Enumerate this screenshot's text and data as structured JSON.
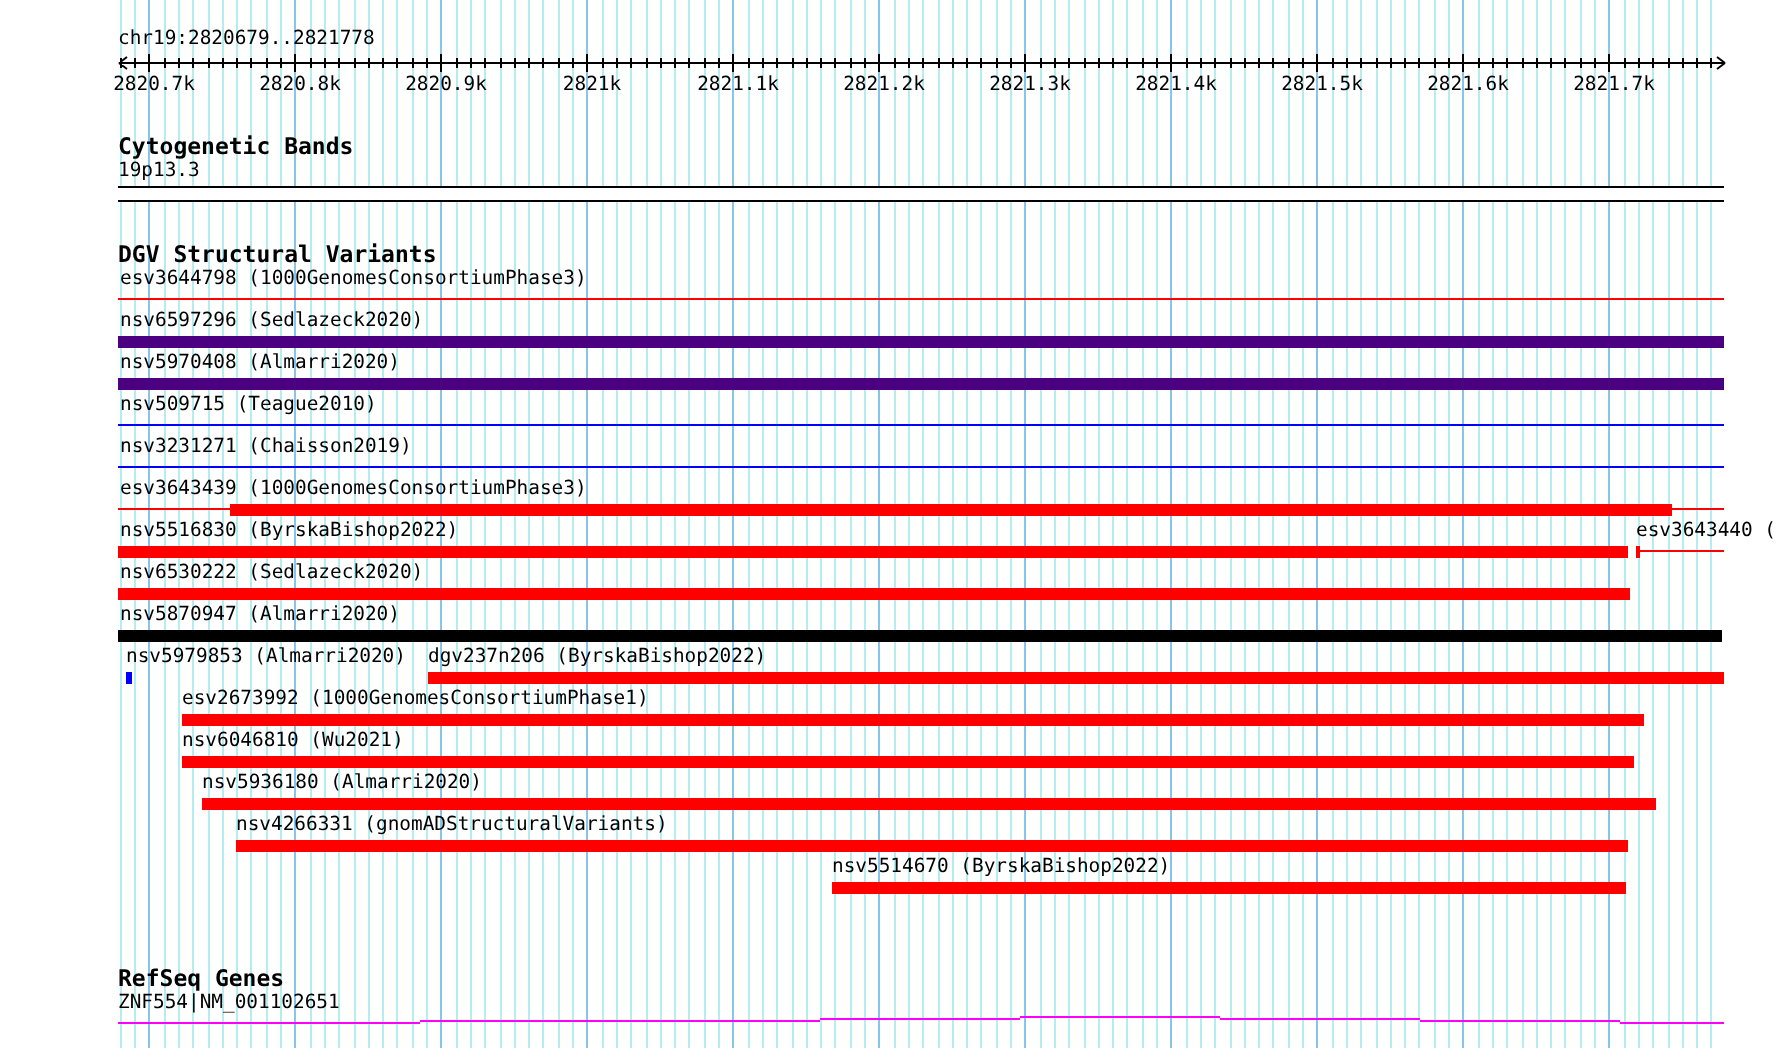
{
  "ruler": {
    "label": "chr19:2820679..2821778",
    "ticks": [
      {
        "label": "2820.7k"
      },
      {
        "label": "2820.8k"
      },
      {
        "label": "2820.9k"
      },
      {
        "label": "2821k"
      },
      {
        "label": "2821.1k"
      },
      {
        "label": "2821.2k"
      },
      {
        "label": "2821.3k"
      },
      {
        "label": "2821.4k"
      },
      {
        "label": "2821.5k"
      },
      {
        "label": "2821.6k"
      },
      {
        "label": "2821.7k"
      }
    ]
  },
  "tracks": [
    {
      "kind": "cytoband",
      "title": "Cytogenetic Bands",
      "band": {
        "label": "19p13.3"
      }
    },
    {
      "kind": "variants",
      "title": "DGV Structural Variants",
      "rows": [
        {
          "features": [
            {
              "label": "esv3644798 (1000GenomesConsortiumPhase3)",
              "kind": "line",
              "color": "#ff0000"
            }
          ]
        },
        {
          "features": [
            {
              "label": "nsv6597296 (Sedlazeck2020)",
              "kind": "bar",
              "color": "#4b0082"
            }
          ]
        },
        {
          "features": [
            {
              "label": "nsv5970408 (Almarri2020)",
              "kind": "bar",
              "color": "#4b0082"
            }
          ]
        },
        {
          "features": [
            {
              "label": "nsv509715 (Teague2010)",
              "kind": "line",
              "color": "#0000ff"
            }
          ]
        },
        {
          "features": [
            {
              "label": "nsv3231271 (Chaisson2019)",
              "kind": "line",
              "color": "#0000ff"
            }
          ]
        },
        {
          "features": [
            {
              "label": "esv3643439 (1000GenomesConsortiumPhase3)",
              "kind": "mixed",
              "color": "#ff0000"
            }
          ]
        },
        {
          "features": [
            {
              "label": "nsv5516830 (ByrskaBishop2022)",
              "kind": "bar",
              "color": "#ff0000"
            },
            {
              "label": "esv3643440 (",
              "kind": "mixed",
              "color": "#ff0000"
            }
          ]
        },
        {
          "features": [
            {
              "label": "nsv6530222 (Sedlazeck2020)",
              "kind": "bar",
              "color": "#ff0000"
            }
          ]
        },
        {
          "features": [
            {
              "label": "nsv5870947 (Almarri2020)",
              "kind": "bar",
              "color": "#000000"
            }
          ]
        },
        {
          "features": [
            {
              "label": "nsv5979853 (Almarri2020)",
              "kind": "bar",
              "color": "#0000ff"
            },
            {
              "label": "dgv237n206 (ByrskaBishop2022)",
              "kind": "bar",
              "color": "#ff0000"
            }
          ]
        },
        {
          "features": [
            {
              "label": "esv2673992 (1000GenomesConsortiumPhase1)",
              "kind": "bar",
              "color": "#ff0000"
            }
          ]
        },
        {
          "features": [
            {
              "label": "nsv6046810 (Wu2021)",
              "kind": "bar",
              "color": "#ff0000"
            }
          ]
        },
        {
          "features": [
            {
              "label": "nsv5936180 (Almarri2020)",
              "kind": "bar",
              "color": "#ff0000"
            }
          ]
        },
        {
          "features": [
            {
              "label": "nsv4266331 (gnomADStructuralVariants)",
              "kind": "bar",
              "color": "#ff0000"
            }
          ]
        },
        {
          "features": [
            {
              "label": "nsv5514670 (ByrskaBishop2022)",
              "kind": "bar",
              "color": "#ff0000"
            }
          ]
        }
      ]
    },
    {
      "kind": "genes",
      "title": "RefSeq Genes",
      "genes": [
        {
          "label": "ZNF554|NM_001102651"
        }
      ]
    }
  ]
}
